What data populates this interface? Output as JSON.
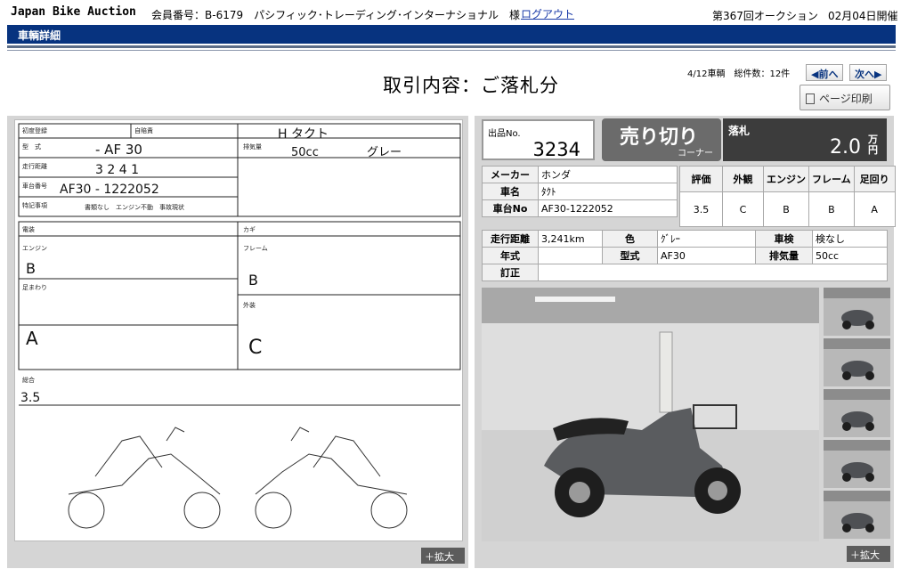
{
  "header": {
    "logo": "Japan Bike Auction",
    "member_info": "会員番号：B-6179　パシフィック･トレーディング･インターナショナル　様",
    "logout": "ログアウト",
    "auction_no": "第367回オークション",
    "date": "02月04日開催"
  },
  "nav": {
    "title": "車輌詳細"
  },
  "page": {
    "title": "取引内容：ご落札分",
    "counter": "4/12車輌　総件数：12件",
    "prev": "◀前へ",
    "next": "次へ▶",
    "print": "ページ印刷"
  },
  "sheet": {
    "model_code": "AF30",
    "chassis_no": "AF30-1222052",
    "name_handwritten": "H タクト",
    "color_handwritten": "グレー",
    "mileage_handwritten": "3241",
    "grade": "3.5",
    "zoom": "＋拡大"
  },
  "lot": {
    "label": "出品No.",
    "number": "3234",
    "sold": "売り切り",
    "corner": "コーナー",
    "price_label": "落札",
    "price": "2.0",
    "price_unit": "万円"
  },
  "specs": {
    "maker_label": "メーカー",
    "maker": "ホンダ",
    "name_label": "車名",
    "name": "ﾀｸﾄ",
    "chassis_label": "車台No",
    "chassis": "AF30-1222052"
  },
  "ratings": {
    "headers": [
      "評価",
      "外観",
      "エンジン",
      "フレーム",
      "足回り"
    ],
    "values": [
      "3.5",
      "C",
      "B",
      "B",
      "A"
    ]
  },
  "details": {
    "mileage_label": "走行距離",
    "mileage": "3,241km",
    "color_label": "色",
    "color": "ｸﾞﾚｰ",
    "inspection_label": "車検",
    "inspection": "検なし",
    "year_label": "年式",
    "year": "",
    "model_label": "型式",
    "model": "AF30",
    "displacement_label": "排気量",
    "displacement": "50cc",
    "correction_label": "訂正",
    "correction": ""
  },
  "photos": {
    "zoom": "＋拡大",
    "thumb_count": 5
  }
}
